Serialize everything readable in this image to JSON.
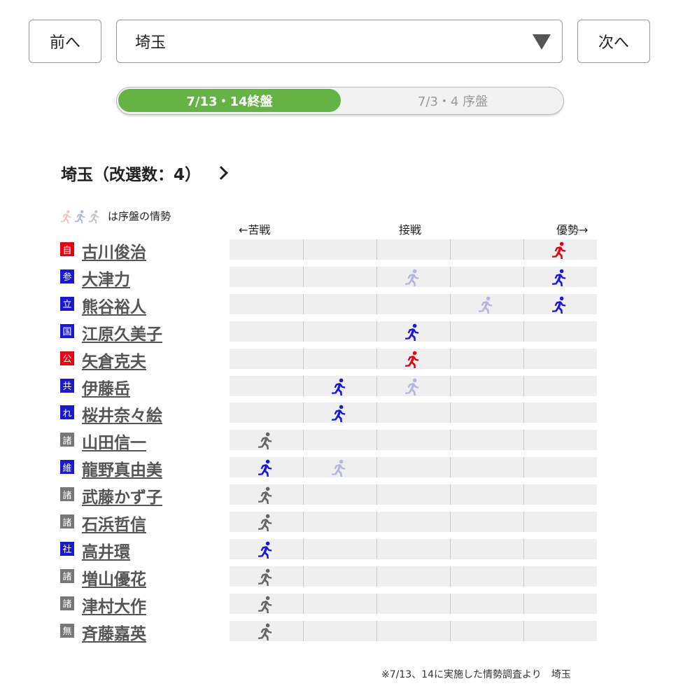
{
  "nav": {
    "prev_label": "前へ",
    "next_label": "次へ"
  },
  "select": {
    "value": "埼玉"
  },
  "period_tabs": {
    "active": "7/13・14終盤",
    "inactive": "7/3・4 序盤"
  },
  "heading": "埼玉（改選数：4）",
  "legend": {
    "text": "は序盤の情勢"
  },
  "scale": {
    "left": "←苦戦",
    "middle": "接戦",
    "right": "優勢→"
  },
  "colors": {
    "gray": "#666666",
    "blue": "#1a1ad6",
    "red": "#e60012",
    "faded_blue": "#b4b4e6",
    "faded_gray": "#c4c4c4",
    "faded_red": "#f2c4c4",
    "active_tab": "#66b345"
  },
  "candidates": [
    {
      "party": "自",
      "party_color": "#e60012",
      "name": "古川俊治",
      "final_level": 5,
      "early_level": 5,
      "runner_color": "red"
    },
    {
      "party": "参",
      "party_color": "#1a1acc",
      "name": "大津力",
      "final_level": 5,
      "early_level": 3,
      "runner_color": "blue"
    },
    {
      "party": "立",
      "party_color": "#1a1acc",
      "name": "熊谷裕人",
      "final_level": 5,
      "early_level": 4,
      "runner_color": "blue"
    },
    {
      "party": "国",
      "party_color": "#1a1acc",
      "name": "江原久美子",
      "final_level": 3,
      "early_level": 3,
      "runner_color": "blue"
    },
    {
      "party": "公",
      "party_color": "#e60012",
      "name": "矢倉克夫",
      "final_level": 3,
      "early_level": 3,
      "runner_color": "red"
    },
    {
      "party": "共",
      "party_color": "#1a1acc",
      "name": "伊藤岳",
      "final_level": 2,
      "early_level": 3,
      "runner_color": "blue"
    },
    {
      "party": "れ",
      "party_color": "#1a1acc",
      "name": "桜井奈々絵",
      "final_level": 2,
      "early_level": 2,
      "runner_color": "blue"
    },
    {
      "party": "諸",
      "party_color": "#777777",
      "name": "山田信一",
      "final_level": 1,
      "early_level": 1,
      "runner_color": "gray"
    },
    {
      "party": "維",
      "party_color": "#1a1acc",
      "name": "龍野真由美",
      "final_level": 1,
      "early_level": 2,
      "runner_color": "blue"
    },
    {
      "party": "諸",
      "party_color": "#777777",
      "name": "武藤かず子",
      "final_level": 1,
      "early_level": 1,
      "runner_color": "gray"
    },
    {
      "party": "諸",
      "party_color": "#777777",
      "name": "石浜哲信",
      "final_level": 1,
      "early_level": 1,
      "runner_color": "gray"
    },
    {
      "party": "社",
      "party_color": "#1a1acc",
      "name": "高井環",
      "final_level": 1,
      "early_level": 1,
      "runner_color": "blue"
    },
    {
      "party": "諸",
      "party_color": "#777777",
      "name": "増山優花",
      "final_level": 1,
      "early_level": 1,
      "runner_color": "gray"
    },
    {
      "party": "諸",
      "party_color": "#777777",
      "name": "津村大作",
      "final_level": 1,
      "early_level": 1,
      "runner_color": "gray"
    },
    {
      "party": "無",
      "party_color": "#777777",
      "name": "斉藤嘉英",
      "final_level": 1,
      "early_level": 1,
      "runner_color": "gray"
    }
  ],
  "footnote": "※7/13、14に実施した情勢調査より　埼玉"
}
